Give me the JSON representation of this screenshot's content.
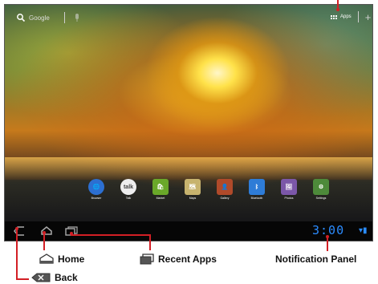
{
  "search": {
    "label": "Google"
  },
  "apps_launcher": {
    "label": "Apps"
  },
  "dock_apps": [
    {
      "name": "Browser",
      "color": "#2c6fd1",
      "glyph": "🌐"
    },
    {
      "name": "Talk",
      "color": "#3a3a3a",
      "glyph": "talk"
    },
    {
      "name": "Market",
      "color": "#6aa829",
      "glyph": "🛍"
    },
    {
      "name": "Maps",
      "color": "#c7b36e",
      "glyph": "🗺"
    },
    {
      "name": "Gallery",
      "color": "#b04a2a",
      "glyph": "👤"
    },
    {
      "name": "Bluetooth",
      "color": "#2e7cd7",
      "glyph": "ᛒ"
    },
    {
      "name": "Photos",
      "color": "#7b57a8",
      "glyph": "🖼"
    },
    {
      "name": "Settings",
      "color": "#4d8a3a",
      "glyph": "⚙"
    }
  ],
  "status": {
    "time": "3:00"
  },
  "callouts": {
    "apps": "Apps",
    "home": "Home",
    "recent_apps": "Recent Apps",
    "notification_panel": "Notification Panel",
    "back": "Back"
  },
  "colors": {
    "leader": "#d31f25",
    "clock": "#2b8cff"
  }
}
